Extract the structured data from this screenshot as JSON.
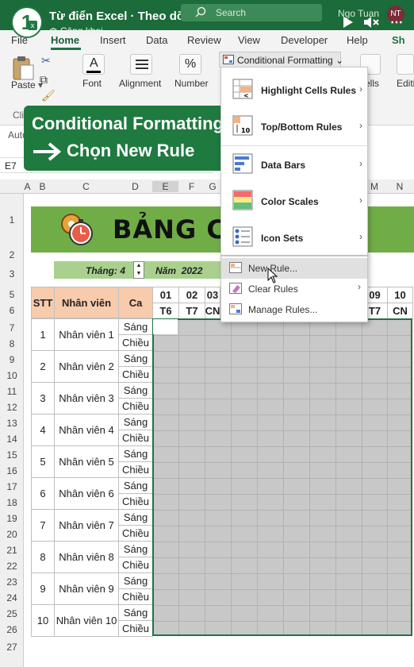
{
  "titlebar": {
    "title": "Từ điển Excel · Theo dõi",
    "privacy": "Công khai",
    "search_placeholder": "Search",
    "user": "Ngo Tuan",
    "avatar_initials": "NT",
    "logo_digit": "1"
  },
  "tabs": [
    "File",
    "Home",
    "Insert",
    "Data",
    "Review",
    "View",
    "Developer",
    "Help",
    "Sh"
  ],
  "ribbon": {
    "paste": "Paste",
    "clipboard": "Clip",
    "font": "Font",
    "alignment": "Alignment",
    "number": "Number",
    "cells": "ells",
    "editing": "Editi",
    "conditional_formatting": "Conditional Formatting"
  },
  "callout": {
    "line1": "Conditional Formatting",
    "line2": "Chọn New Rule"
  },
  "autocomplete_text": "Auto",
  "namebox": "E7",
  "cf_menu": {
    "items": [
      "Highlight Cells Rules",
      "Top/Bottom Rules",
      "Data Bars",
      "Color Scales",
      "Icon Sets"
    ],
    "sub_items": [
      "New Rule...",
      "Clear Rules",
      "Manage Rules..."
    ]
  },
  "columns": [
    "A",
    "B",
    "C",
    "D",
    "E",
    "F",
    "G",
    "M",
    "N"
  ],
  "rows": [
    "1",
    "2",
    "3",
    "5",
    "6",
    "7",
    "8",
    "9",
    "10",
    "11",
    "12",
    "13",
    "14",
    "15",
    "16",
    "17",
    "18",
    "19",
    "20",
    "21",
    "22",
    "23",
    "24",
    "25",
    "26",
    "27"
  ],
  "sheet": {
    "banner_title": "BẢNG CHẤM",
    "month_label": "Tháng:",
    "month_value": "4",
    "year_label": "Năm",
    "year_value": "2022",
    "headers": {
      "stt": "STT",
      "employee": "Nhân viên",
      "shift": "Ca"
    },
    "day_numbers": [
      "01",
      "02",
      "03",
      "09",
      "10"
    ],
    "weekdays": [
      "T6",
      "T7",
      "CN",
      "T7",
      "CN"
    ],
    "shifts": [
      "Sáng",
      "Chiều"
    ],
    "employees": [
      {
        "stt": "1",
        "name": "Nhân viên 1"
      },
      {
        "stt": "2",
        "name": "Nhân viên 2"
      },
      {
        "stt": "3",
        "name": "Nhân viên 3"
      },
      {
        "stt": "4",
        "name": "Nhân viên 4"
      },
      {
        "stt": "5",
        "name": "Nhân viên 5"
      },
      {
        "stt": "6",
        "name": "Nhân viên 6"
      },
      {
        "stt": "7",
        "name": "Nhân viên 7"
      },
      {
        "stt": "8",
        "name": "Nhân viên 8"
      },
      {
        "stt": "9",
        "name": "Nhân viên 9"
      },
      {
        "stt": "10",
        "name": "Nhân viên 10"
      }
    ]
  },
  "colors": {
    "excel_green": "#217346",
    "header_fill": "#f8cbad",
    "banner_fill": "#70ad47",
    "selection_gray": "#c8c8c8"
  }
}
